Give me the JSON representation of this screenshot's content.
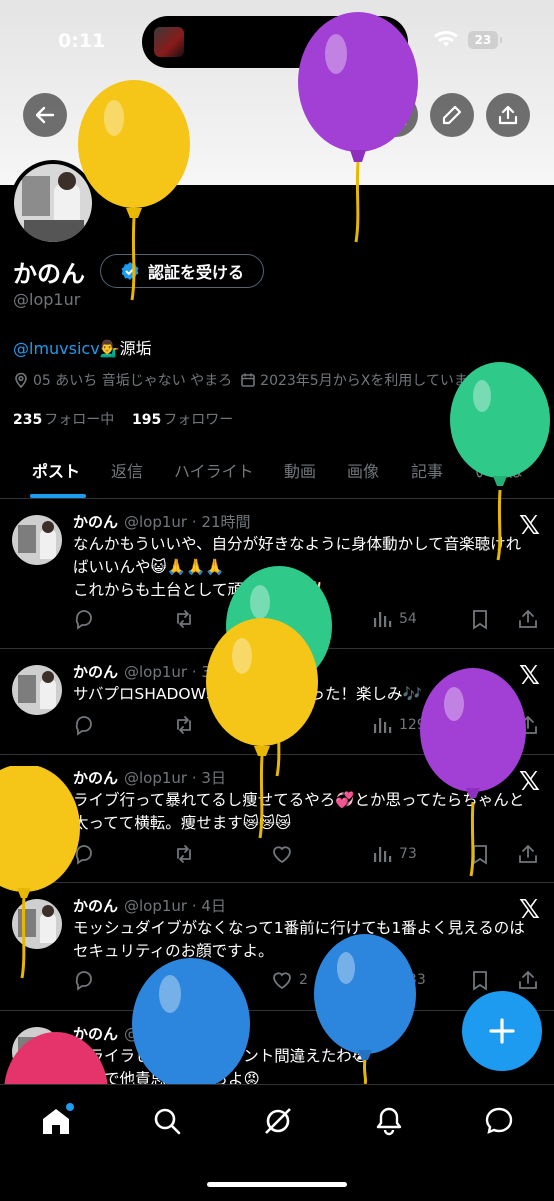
{
  "status_bar": {
    "time": "0:11",
    "battery": "23"
  },
  "profile": {
    "name": "かのん",
    "verify_label": "認証を受ける",
    "handle": "@lop1ur",
    "bio_link": "@lmuvsicv",
    "bio_emoji": "💁‍♂️",
    "bio_suffix": "源垢",
    "location": "05 あいち 音垢じゃない やまろ",
    "joined": "2023年5月からXを利用しています",
    "following_count": "235",
    "following_label": "フォロー中",
    "followers_count": "195",
    "followers_label": "フォロワー"
  },
  "tabs": [
    "ポスト",
    "返信",
    "ハイライト",
    "動画",
    "画像",
    "記事",
    "いいね"
  ],
  "posts": [
    {
      "name": "かのん",
      "handle": "@lop1ur",
      "time": "21時間",
      "line1": "なんかもういいや、自分が好きなように身体動かして音楽聴けれ",
      "line2": "ばいいんや😺🙏🙏🙏",
      "line3": "これからも土台として頑張るぞ😆✌🏻",
      "likes": "1",
      "views": "54"
    },
    {
      "name": "かのん",
      "handle": "@lop1ur",
      "time": "3日",
      "line1": "サバプロSHADOWSの対バン当たった！楽しみ🎶",
      "likes": "",
      "views": "129"
    },
    {
      "name": "かのん",
      "handle": "@lop1ur",
      "time": "3日",
      "line1": "ライブ行って暴れてるし痩せてるやろ💞とか思ってたらちゃんと",
      "line2": "太ってて横転。痩せます😿😿😿",
      "likes": "",
      "views": "73"
    },
    {
      "name": "かのん",
      "handle": "@lop1ur",
      "time": "4日",
      "line1": "モッシュダイブがなくなって1番前に行けても1番よく見えるのは",
      "line2": "セキュリティのお顔ですよ。",
      "likes": "2",
      "views": "133"
    },
    {
      "name": "かのん",
      "handle": "@lop1ur",
      "time": "4日",
      "line1": "イライラしすぎてアカウント間違えたわ😭",
      "line2": "がちで他責思考やめろよ😡"
    }
  ],
  "x_logo": "𝕏",
  "colors": {
    "accent": "#1d9bf0",
    "background": "#000000",
    "secondary_text": "#71767b"
  },
  "icons": [
    "back-icon",
    "grok-icon",
    "search-icon",
    "edit-icon",
    "share-icon",
    "home-icon",
    "explore-icon",
    "grok-nav-icon",
    "notifications-icon",
    "messages-icon",
    "plus-icon"
  ]
}
